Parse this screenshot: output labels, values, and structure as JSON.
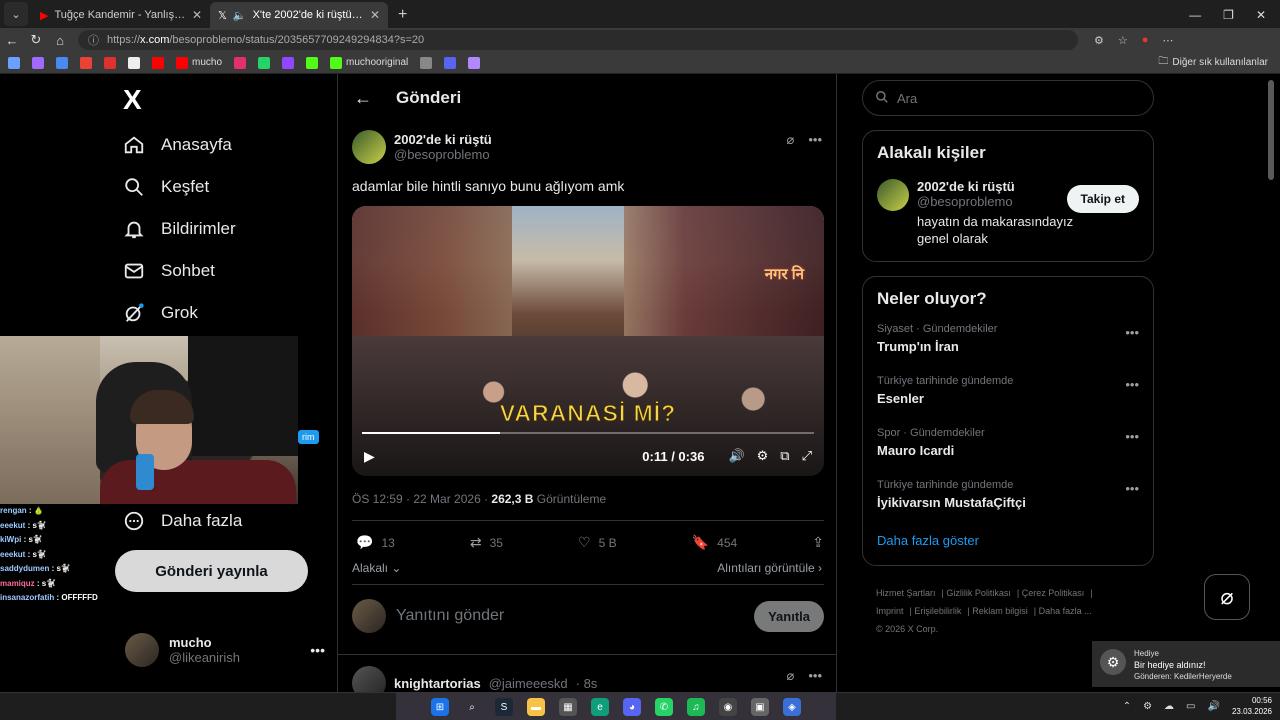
{
  "browser": {
    "tabs": [
      {
        "title": "Tuğçe Kandemir - Yanlış x Simge -",
        "active": false
      },
      {
        "title": "X'te 2002'de ki rüştü: \"adamla",
        "active": true
      }
    ],
    "url_prefix": "https://",
    "url_host": "x.com",
    "url_path": "/besoproblemo/status/2035657709249294834?s=20",
    "bookmarks": [
      "mucho",
      "muchooriginal"
    ],
    "bookmarks_folder": "Diğer sık kullanılanlar"
  },
  "nav": {
    "logo": "X",
    "items": [
      "Anasayfa",
      "Keşfet",
      "Bildirimler",
      "Sohbet",
      "Grok",
      "Daha fazla"
    ],
    "post_button": "Gönderi yayınla",
    "account_name": "mucho",
    "account_handle": "@likeanirish"
  },
  "post": {
    "header_title": "Gönderi",
    "author_name": "2002'de ki rüştü",
    "author_handle": "@besoproblemo",
    "text": "adamlar bile hintli sanıyo bunu ağlıyom amk",
    "video": {
      "overlay_text": "VARANASİ Mİ?",
      "sign_text": "नगर नि",
      "time": "0:11 / 0:36",
      "progress": 0.305
    },
    "timestamp": "ÖS 12:59 · 22 Mar 2026 · ",
    "views": "262,3 B",
    "views_label": " Görüntüleme",
    "replies": "13",
    "reposts": "35",
    "likes": "5 B",
    "bookmarks": "454",
    "related_label": "Alakalı",
    "quotes_label": "Alıntıları görüntüle",
    "reply_placeholder": "Yanıtını gönder",
    "reply_button": "Yanıtla",
    "next_author_name": "knightartorias",
    "next_author_handle": "@jaimeeeskd",
    "next_time": "· 8s"
  },
  "right": {
    "search_placeholder": "Ara",
    "related_title": "Alakalı kişiler",
    "related_name": "2002'de ki rüştü",
    "related_handle": "@besoproblemo",
    "related_bio": "hayatın da makarasındayız genel olarak",
    "follow_button": "Takip et",
    "trends_title": "Neler oluyor?",
    "trends": [
      {
        "category": "Siyaset · Gündemdekiler",
        "name": "Trump'ın İran"
      },
      {
        "category": "Türkiye tarihinde gündemde",
        "name": "Esenler"
      },
      {
        "category": "Spor · Gündemdekiler",
        "name": "Mauro Icardi"
      },
      {
        "category": "Türkiye tarihinde gündemde",
        "name": "İyikivarsın MustafaÇiftçi"
      }
    ],
    "show_more": "Daha fazla göster",
    "footer": [
      "Hizmet Şartları",
      "Gizlilik Politikası",
      "Çerez Politikası",
      "Imprint",
      "Erişilebilirlik",
      "Reklam bilgisi",
      "Daha fazla ...",
      "© 2026 X Corp."
    ]
  },
  "stream": {
    "badge": "rim",
    "chat": [
      {
        "user": "rengan",
        "msg": " : 🍐"
      },
      {
        "user": "eeekut",
        "msg": " : s🐩"
      },
      {
        "user": "kiWpi",
        "msg": " : s🐩"
      },
      {
        "user": "eeekut",
        "msg": " : s🐩"
      },
      {
        "user": "saddydumen",
        "msg": " : s🐩"
      },
      {
        "user": "mamiquz",
        "msg": " : s🐩"
      },
      {
        "user": "insanazorfatih",
        "msg": " : OFFFFFD"
      }
    ]
  },
  "toast": {
    "app": "Hediye",
    "title": "Bir hediye aldınız!",
    "from": "Gönderen: KedilerHeryerde"
  },
  "taskbar": {
    "time": "00:56",
    "date": "23.03.2026"
  },
  "colors": {
    "accent": "#1d9bf0",
    "border": "#2f3336",
    "muted": "#71767b"
  }
}
